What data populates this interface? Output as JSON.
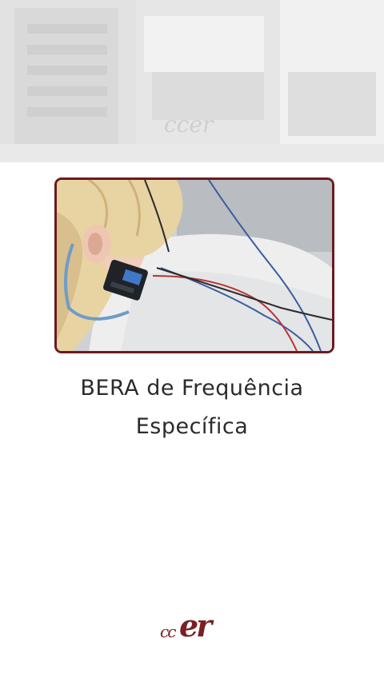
{
  "caption": {
    "line1": "BERA de Frequência",
    "line2": "Específica"
  },
  "logo": {
    "part_small": "cc",
    "part_big": "er",
    "color": "#7a1f22"
  },
  "photo": {
    "frame_color": "#6b1b1e"
  }
}
